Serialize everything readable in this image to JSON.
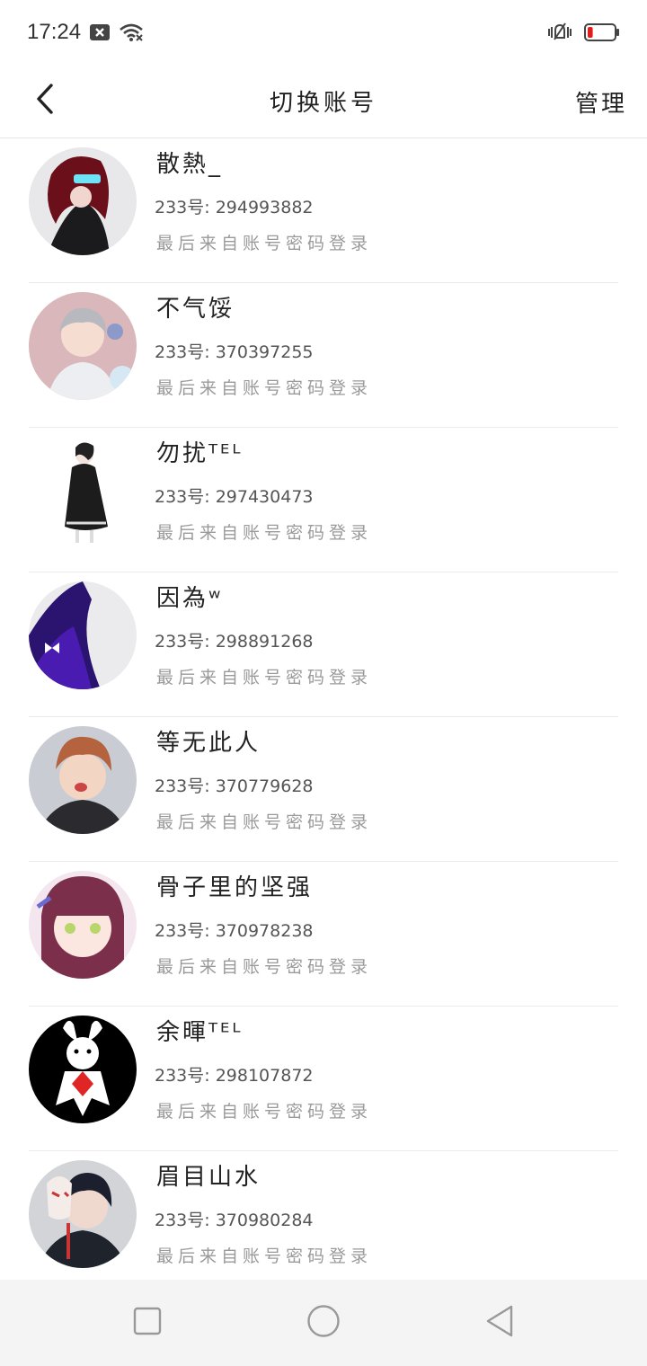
{
  "status_bar": {
    "time": "17:24",
    "icons_left": [
      "sim-x-icon",
      "wifi-icon"
    ],
    "icons_right": [
      "vibrate-mute-icon",
      "battery-low-icon"
    ],
    "battery_level": 0.1,
    "battery_color": "#e21b1b"
  },
  "header": {
    "title": "切换账号",
    "manage_label": "管理",
    "back_icon": "chevron-left-icon"
  },
  "accounts": [
    {
      "name": "散熱_",
      "id_text": "233号: 294993882",
      "source": "最后来自账号密码登录"
    },
    {
      "name": "不气馁",
      "id_text": "233号: 370397255",
      "source": "最后来自账号密码登录"
    },
    {
      "name": "勿扰ᵀᴱᴸ",
      "id_text": "233号: 297430473",
      "source": "最后来自账号密码登录"
    },
    {
      "name": "因為ʷ",
      "id_text": "233号: 298891268",
      "source": "最后来自账号密码登录"
    },
    {
      "name": "等无此人",
      "id_text": "233号: 370779628",
      "source": "最后来自账号密码登录"
    },
    {
      "name": "骨子里的坚强",
      "id_text": "233号: 370978238",
      "source": "最后来自账号密码登录"
    },
    {
      "name": "余暉ᵀᴱᴸ",
      "id_text": "233号: 298107872",
      "source": "最后来自账号密码登录"
    },
    {
      "name": "眉目山水",
      "id_text": "233号: 370980284",
      "source": "最后来自账号密码登录"
    }
  ],
  "nav_bar": {
    "icons": [
      "recent-apps-square-icon",
      "home-circle-icon",
      "back-triangle-icon"
    ]
  }
}
